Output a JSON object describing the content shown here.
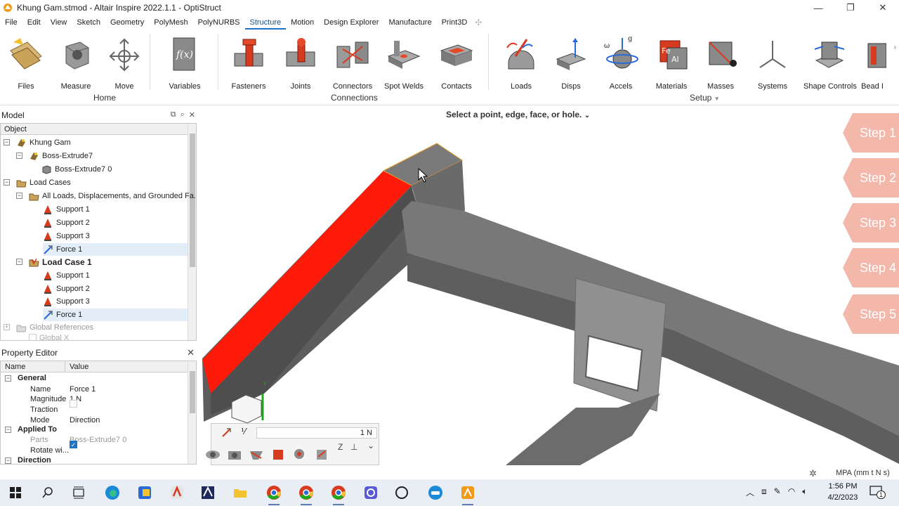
{
  "window": {
    "title": "Khung Gam.stmod - Altair Inspire 2022.1.1 - OptiStruct",
    "minimize": "—",
    "restore": "❐",
    "close": "✕"
  },
  "menu": {
    "items": [
      "File",
      "Edit",
      "View",
      "Sketch",
      "Geometry",
      "PolyMesh",
      "PolyNURBS",
      "Structure",
      "Motion",
      "Design Explorer",
      "Manufacture",
      "Print3D"
    ],
    "active": "Structure"
  },
  "ribbon": {
    "tools": {
      "files": "Files",
      "measure": "Measure",
      "move": "Move",
      "variables": "Variables",
      "fasteners": "Fasteners",
      "joints": "Joints",
      "connectors": "Connectors",
      "spot_welds": "Spot Welds",
      "contacts": "Contacts",
      "loads": "Loads",
      "disps": "Disps",
      "accels": "Accels",
      "materials": "Materials",
      "masses": "Masses",
      "systems": "Systems",
      "shape_controls": "Shape Controls",
      "bead": "Bead I"
    },
    "groups": {
      "home": "Home",
      "connections": "Connections",
      "setup": "Setup"
    }
  },
  "model_panel": {
    "title": "Model",
    "column": "Object",
    "items": [
      {
        "label": "Khung Gam"
      },
      {
        "label": "Boss-Extrude7"
      },
      {
        "label": "Boss-Extrude7 0"
      },
      {
        "label": "Load Cases"
      },
      {
        "label": "All Loads, Displacements, and Grounded Fa..."
      },
      {
        "label": "Support 1"
      },
      {
        "label": "Support 2"
      },
      {
        "label": "Support 3"
      },
      {
        "label": "Force 1"
      },
      {
        "label": "Load Case 1"
      },
      {
        "label": "Support 1"
      },
      {
        "label": "Support 2"
      },
      {
        "label": "Support 3"
      },
      {
        "label": "Force 1"
      },
      {
        "label": "Global References"
      },
      {
        "label": "Global X"
      }
    ]
  },
  "property_editor": {
    "title": "Property Editor",
    "col_name": "Name",
    "col_value": "Value",
    "general": "General",
    "rows": {
      "name_label": "Name",
      "name_value": "Force 1",
      "magnitude_label": "Magnitude",
      "magnitude_value": "1 N",
      "traction_label": "Traction",
      "mode_label": "Mode",
      "mode_value": "Direction"
    },
    "applied_to": "Applied To",
    "parts_label": "Parts",
    "parts_value": "Boss-Extrude7 0",
    "rotate_label": "Rotate wi...",
    "direction": "Direction"
  },
  "viewport": {
    "prompt": "Select a point, edge, face, or hole.",
    "steps": [
      "Step 1",
      "Step 2",
      "Step 3",
      "Step 4",
      "Step 5"
    ],
    "units": "MPA (mm t N s)",
    "micro_value": "1 N",
    "triad_label": "Y",
    "micro_glyphs": {
      "frac": "⅟",
      "z": "Z",
      "down": "⌄"
    }
  },
  "colors": {
    "accent": "#1b74c8",
    "step_fill": "#f3b8aa",
    "selected_face": "#ff1a0a",
    "part_gray": "#6e6e6e"
  },
  "taskbar": {
    "time": "1:56 PM",
    "date": "4/2/2023",
    "notif": "1"
  }
}
